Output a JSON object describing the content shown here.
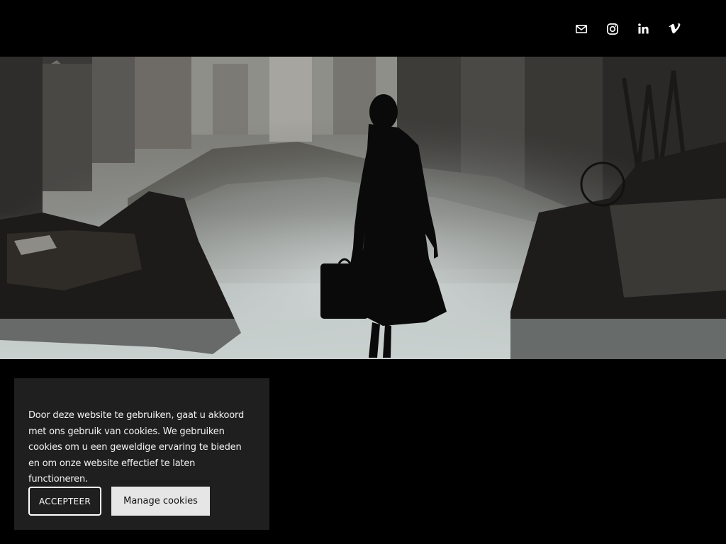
{
  "header": {
    "social_links": [
      {
        "name": "email",
        "icon": "mail-icon"
      },
      {
        "name": "instagram",
        "icon": "instagram-icon"
      },
      {
        "name": "linkedin",
        "icon": "linkedin-icon"
      },
      {
        "name": "vimeo",
        "icon": "vimeo-icon"
      }
    ]
  },
  "hero": {
    "image": "silhouette-woman-suitcase-ruined-street-fog"
  },
  "cookie_banner": {
    "message": "Door deze website te gebruiken, gaat u akkoord met ons gebruik van cookies. We gebruiken cookies om u een geweldige ervaring te bieden en om onze website effectief te laten functioneren.",
    "accept_label": "ACCEPTEER",
    "manage_label": "Manage cookies"
  },
  "colors": {
    "background": "#000000",
    "banner_bg": "#1f1f1f",
    "manage_button_bg": "#e6e6e6",
    "text": "#f2f2f2"
  }
}
